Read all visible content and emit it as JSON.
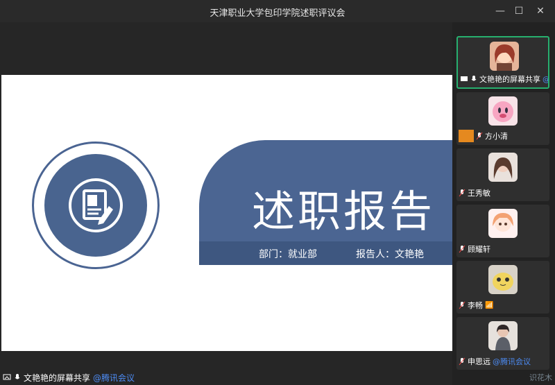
{
  "window": {
    "title": "天津职业大学包印学院述职评议会",
    "controls": [
      "minimize-icon",
      "maximize-icon",
      "close-icon"
    ]
  },
  "slide": {
    "title": "述职报告",
    "department": "部门：就业部",
    "reporter": "报告人：文艳艳"
  },
  "bottom_bar": {
    "share_text": "文艳艳的屏幕共享",
    "mention": "@腾讯会议"
  },
  "participants": [
    {
      "label": "文艳艳的屏幕共享",
      "mention": "@",
      "icon": "screen-share-icon",
      "active": true
    },
    {
      "label": "方小清"
    },
    {
      "label": "王秀敏"
    },
    {
      "label": "顾耀轩"
    },
    {
      "label": "李畅",
      "signal": "📶"
    },
    {
      "label": "申思远",
      "mention": "@腾讯会议"
    }
  ],
  "watermark": "识花木",
  "colors": {
    "slide_blue": "#4b6592",
    "active_border": "#27b06f",
    "mention_blue": "#4d8cf5"
  }
}
